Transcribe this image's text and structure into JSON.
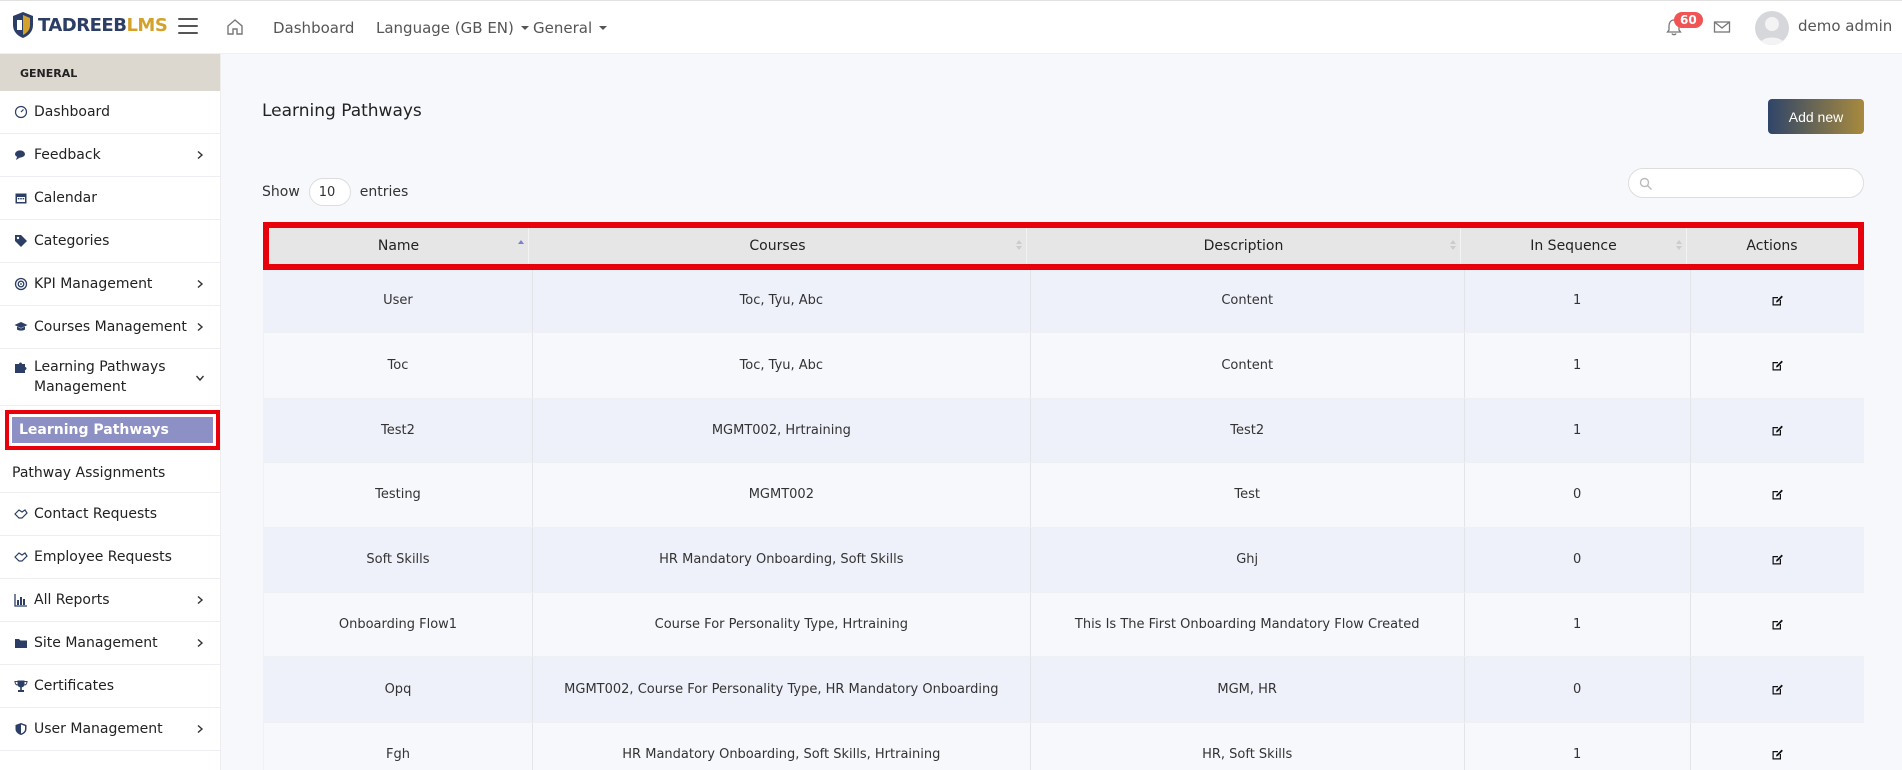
{
  "logo": {
    "part1": "TADREEB",
    "part2": "LMS"
  },
  "topnav": {
    "dashboard": "Dashboard",
    "language": "Language (GB EN)",
    "general": "General"
  },
  "header_right": {
    "notification_count": "60",
    "username": "demo admin"
  },
  "sidebar": {
    "section": "GENERAL",
    "items": [
      {
        "label": "Dashboard"
      },
      {
        "label": "Feedback"
      },
      {
        "label": "Calendar"
      },
      {
        "label": "Categories"
      },
      {
        "label": "KPI Management"
      },
      {
        "label": "Courses Management"
      },
      {
        "label": "Learning Pathways Management"
      }
    ],
    "sub_active": "Learning Pathways",
    "sub_plain": "Pathway Assignments",
    "items2": [
      {
        "label": "Contact Requests"
      },
      {
        "label": "Employee Requests"
      },
      {
        "label": "All Reports"
      },
      {
        "label": "Site Management"
      },
      {
        "label": "Certificates"
      },
      {
        "label": "User Management"
      }
    ]
  },
  "main": {
    "title": "Learning Pathways",
    "add_button": "Add new",
    "show_label": "Show",
    "entries_value": "10",
    "entries_label": "entries",
    "search_placeholder": ""
  },
  "table": {
    "columns": [
      "Name",
      "Courses",
      "Description",
      "In Sequence",
      "Actions"
    ],
    "rows": [
      [
        "User",
        "Toc, Tyu, Abc",
        "Content",
        "1"
      ],
      [
        "Toc",
        "Toc, Tyu, Abc",
        "Content",
        "1"
      ],
      [
        "Test2",
        "MGMT002, Hrtraining",
        "Test2",
        "1"
      ],
      [
        "Testing",
        "MGMT002",
        "Test",
        "0"
      ],
      [
        "Soft Skills",
        "HR Mandatory Onboarding, Soft Skills",
        "Ghj",
        "0"
      ],
      [
        "Onboarding Flow1",
        "Course For Personality Type, Hrtraining",
        "This Is The First Onboarding Mandatory Flow Created",
        "1"
      ],
      [
        "Opq",
        "MGMT002, Course For Personality Type, HR Mandatory Onboarding",
        "MGM, HR",
        "0"
      ],
      [
        "Fgh",
        "HR Mandatory Onboarding, Soft Skills, Hrtraining",
        "HR, Soft Skills",
        "1"
      ]
    ]
  },
  "colors": {
    "highlight_red": "#e8000b",
    "active_item_bg": "#8d90c4",
    "badge_bg": "#f05454"
  }
}
